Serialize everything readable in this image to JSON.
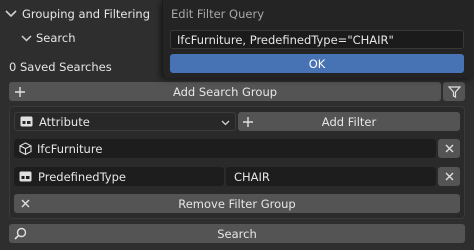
{
  "panel": {
    "section_title": "Grouping and Filtering",
    "subsection_title": "Search",
    "saved_searches": "0 Saved Searches",
    "add_search_group": "Add Search Group",
    "filter_row": {
      "type_selected": "Attribute",
      "add_filter": "Add Filter"
    },
    "filters": [
      {
        "value": "IfcFurniture"
      },
      {
        "attribute": "PredefinedType",
        "value": "CHAIR"
      }
    ],
    "remove_filter_group": "Remove Filter Group",
    "search_button": "Search"
  },
  "popup": {
    "title": "Edit Filter Query",
    "query_value": "IfcFurniture, PredefinedType=\"CHAIR\"",
    "ok_label": "OK"
  },
  "colors": {
    "background": "#2e2e2e",
    "button": "#545454",
    "field": "#1d1d1d",
    "popup_bg": "#242424",
    "ok_accent": "#4772b3"
  }
}
